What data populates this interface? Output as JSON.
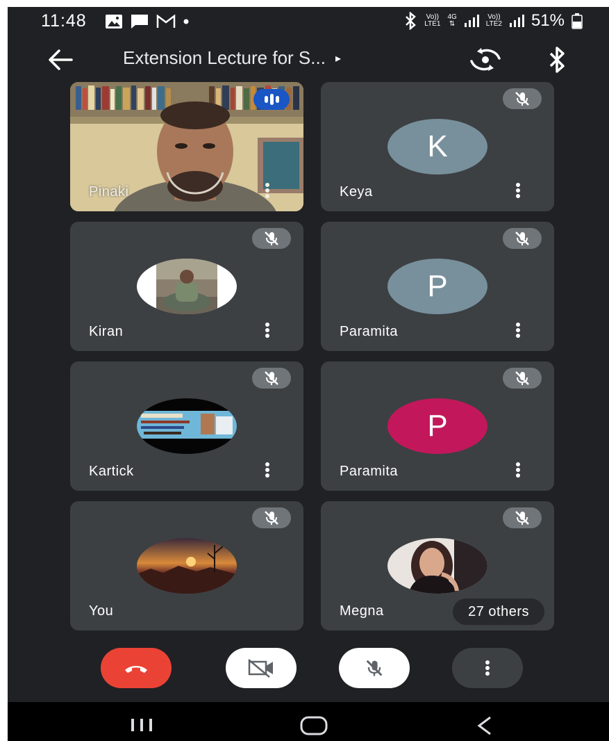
{
  "status_bar": {
    "time": "11:48",
    "battery": "51%",
    "volte1": "Vo))",
    "lte1": "LTE1",
    "net": "4G",
    "volte2": "Vo))",
    "lte2": "LTE2"
  },
  "top_bar": {
    "title": "Extension Lecture for S...",
    "title_chevron": "▸"
  },
  "participants": [
    {
      "name": "Pinaki",
      "type": "video",
      "speaking": true
    },
    {
      "name": "Keya",
      "type": "initial",
      "initial": "K",
      "color": "#78909c",
      "muted": true
    },
    {
      "name": "Kiran",
      "type": "photo",
      "muted": true
    },
    {
      "name": "Paramita",
      "type": "initial",
      "initial": "P",
      "color": "#78909c",
      "muted": true
    },
    {
      "name": "Kartick",
      "type": "photo",
      "muted": true
    },
    {
      "name": "Paramita",
      "type": "initial",
      "initial": "P",
      "color": "#c2185b",
      "muted": true
    },
    {
      "name": "You",
      "type": "photo",
      "muted": true
    },
    {
      "name": "Megna",
      "type": "photo",
      "muted": true
    }
  ],
  "others_chip": "27 others",
  "colors": {
    "background": "#202124",
    "tile": "#3c4043",
    "end_call": "#ea4335",
    "speaking": "#1a56c4"
  },
  "icons": {
    "back": "arrow-left-icon",
    "switch_camera": "switch-camera-icon",
    "bluetooth": "bluetooth-icon",
    "mic_off": "mic-off-icon",
    "more": "more-vertical-icon",
    "end_call": "phone-hangup-icon",
    "camera_off": "video-off-icon"
  }
}
